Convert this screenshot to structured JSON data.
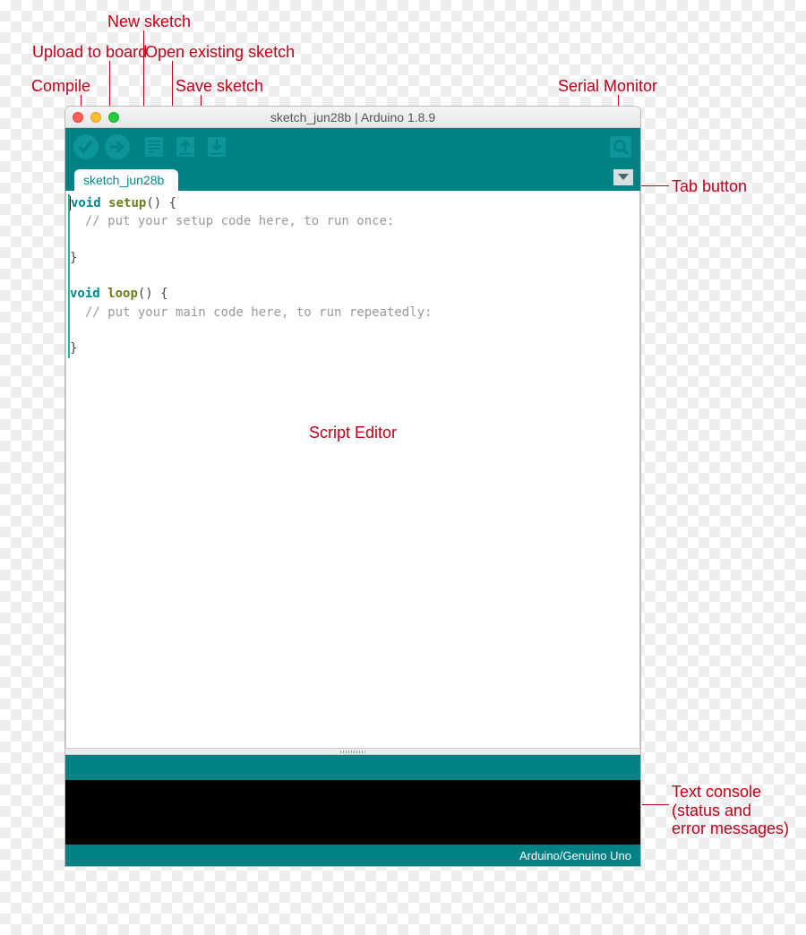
{
  "annotations": {
    "compile": "Compile",
    "upload": "Upload to board",
    "new": "New sketch",
    "open": "Open existing sketch",
    "save": "Save sketch",
    "serial": "Serial Monitor",
    "tab": "Tab button",
    "console": "Text console\n(status and\nerror messages)",
    "editor": "Script Editor"
  },
  "window": {
    "title": "sketch_jun28b | Arduino 1.8.9",
    "tab_name": "sketch_jun28b",
    "board_info": "Arduino/Genuino Uno"
  },
  "code": {
    "setup_sig_kw": "void",
    "setup_sig_fn": "setup",
    "setup_sig_tail": "() {",
    "setup_comment": "  // put your setup code here, to run once:",
    "close_brace": "}",
    "loop_sig_kw": "void",
    "loop_sig_fn": "loop",
    "loop_sig_tail": "() {",
    "loop_comment": "  // put your main code here, to run repeatedly:"
  }
}
